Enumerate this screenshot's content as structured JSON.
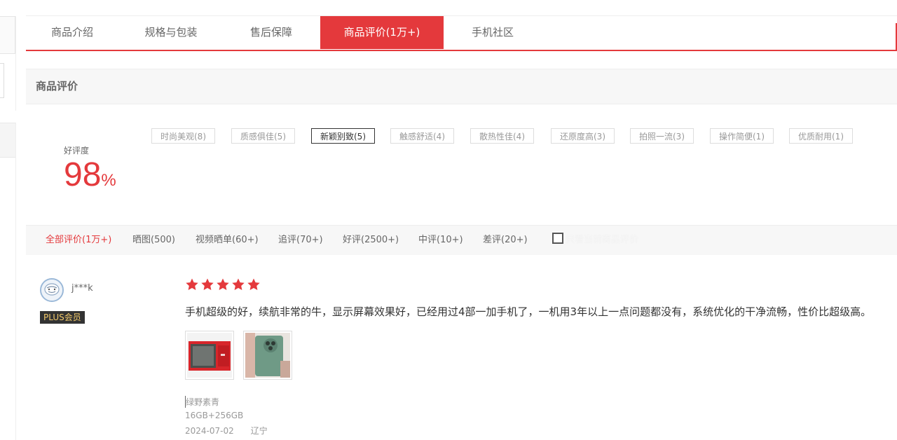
{
  "tabs": [
    {
      "label": "商品介绍"
    },
    {
      "label": "规格与包装"
    },
    {
      "label": "售后保障"
    },
    {
      "label": "商品评价(1万+)",
      "active": true
    },
    {
      "label": "手机社区"
    }
  ],
  "section_title": "商品评价",
  "rating": {
    "label": "好评度",
    "value": "98",
    "unit": "%"
  },
  "tags": [
    {
      "label": "时尚美观(8)"
    },
    {
      "label": "质感俱佳(5)"
    },
    {
      "label": "新颖别致(5)",
      "selected": true
    },
    {
      "label": "触感舒适(4)"
    },
    {
      "label": "散热性佳(4)"
    },
    {
      "label": "还原度高(3)"
    },
    {
      "label": "拍照一流(3)"
    },
    {
      "label": "操作简便(1)"
    },
    {
      "label": "优质耐用(1)"
    }
  ],
  "filters": [
    {
      "label": "全部评价(1万+)",
      "active": true
    },
    {
      "label": "晒图(500)"
    },
    {
      "label": "视频晒单(60+)"
    },
    {
      "label": "追评(70+)"
    },
    {
      "label": "好评(2500+)"
    },
    {
      "label": "中评(10+)"
    },
    {
      "label": "差评(20+)"
    }
  ],
  "filter_checkbox_label": "只看当前商品评价",
  "review": {
    "user_name": "j***k",
    "badge": "PLUS会员",
    "stars": 5,
    "comment": "手机超级的好，续航非常的牛，显示屏幕效果好，已经用过4部一加手机了，一机用3年以上一点问题都没有，系统优化的干净流畅，性价比超级高。",
    "color": "绿野素青",
    "spec": "16GB+256GB",
    "date": "2024-07-02",
    "location": "辽宁"
  },
  "colors": {
    "accent": "#e4393c",
    "badge_bg": "#333333",
    "badge_text": "#f2c96a"
  }
}
